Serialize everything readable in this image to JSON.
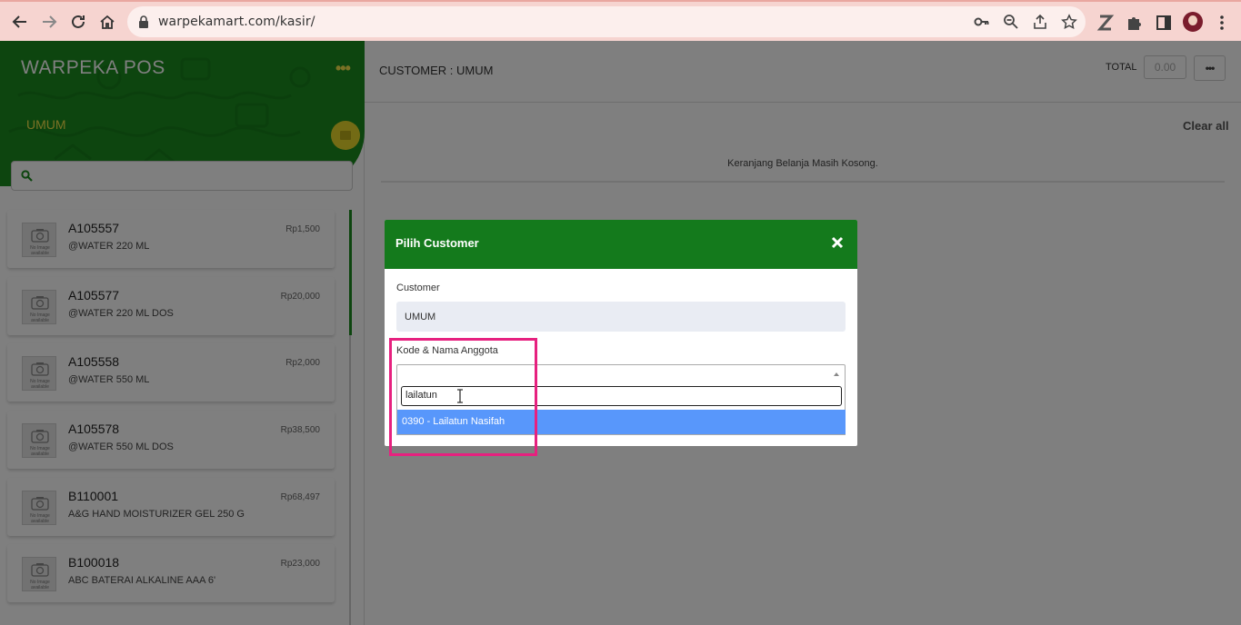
{
  "browser": {
    "url": "warpekamart.com/kasir/"
  },
  "sidebar": {
    "brand": "WARPEKA POS",
    "menu_dots": "•••",
    "customer": "UMUM",
    "search_placeholder": ""
  },
  "products": [
    {
      "code": "A105557",
      "name": "@WATER 220 ML",
      "price": "Rp1,500"
    },
    {
      "code": "A105577",
      "name": "@WATER 220 ML DOS",
      "price": "Rp20,000"
    },
    {
      "code": "A105558",
      "name": "@WATER 550 ML",
      "price": "Rp2,000"
    },
    {
      "code": "A105578",
      "name": "@WATER 550 ML DOS",
      "price": "Rp38,500"
    },
    {
      "code": "B110001",
      "name": "A&G HAND MOISTURIZER GEL 250 G",
      "price": "Rp68,497"
    },
    {
      "code": "B100018",
      "name": "ABC BATERAI ALKALINE AAA 6'",
      "price": "Rp23,000"
    }
  ],
  "no_image_text": "No Image available",
  "cart": {
    "customer_title": "CUSTOMER : UMUM",
    "total_label": "TOTAL",
    "total_value": "0.00",
    "more": "•••",
    "clear_all": "Clear all",
    "empty_message": "Keranjang Belanja Masih Kosong."
  },
  "modal": {
    "title": "Pilih Customer",
    "customer_label": "Customer",
    "customer_value": "UMUM",
    "kode_label": "Kode & Nama Anggota",
    "search_value": "lailatun",
    "option": "0390 - Lailatun Nasifah"
  },
  "colors": {
    "brand_green": "#1a8a1e",
    "modal_header": "#147a1c",
    "accent_yellow": "#f3e24a",
    "option_highlight": "#5897fb",
    "annotation_box": "#e6217f"
  }
}
